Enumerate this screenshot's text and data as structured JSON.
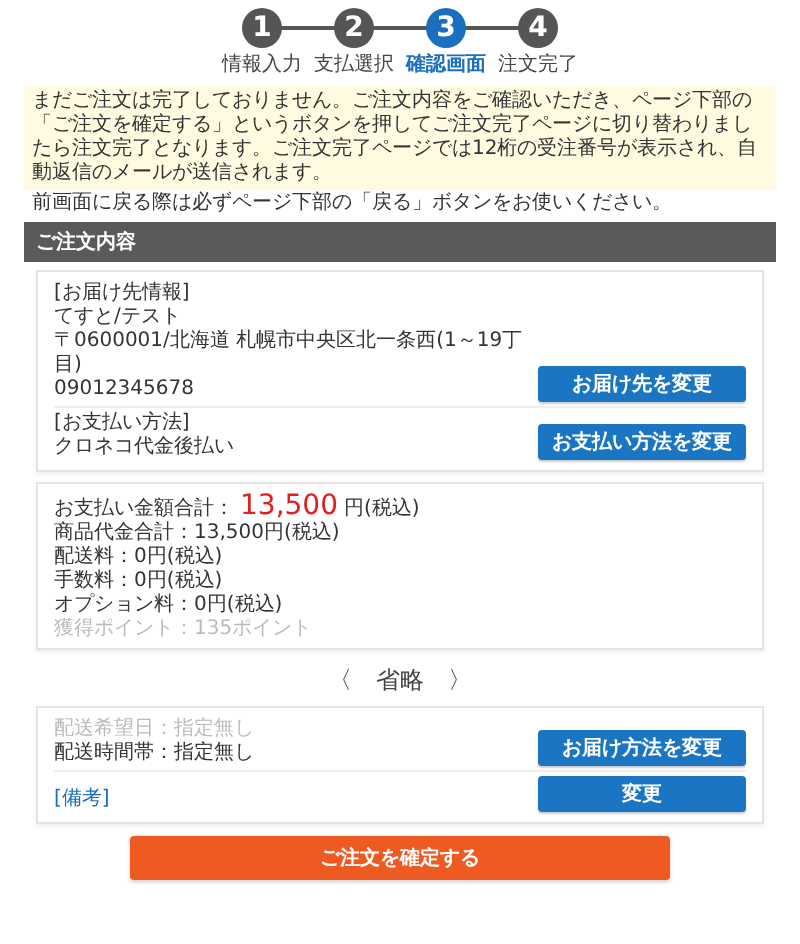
{
  "steps": [
    {
      "number": "1",
      "label": "情報入力",
      "selected": false
    },
    {
      "number": "2",
      "label": "支払選択",
      "selected": false
    },
    {
      "number": "3",
      "label": "確認画面",
      "selected": true
    },
    {
      "number": "4",
      "label": "注文完了",
      "selected": false
    }
  ],
  "notice": {
    "text": "まだご注文は完了しておりません。ご注文内容をご確認いただき、ページ下部の「ご注文を確定する」というボタンを押してご注文完了ページに切り替わりましたら注文完了となります。ご注文完了ページでは12桁の受注番号が表示され、自動返信のメールが送信されます。",
    "note": "前画面に戻る際は必ずページ下部の「戻る」ボタンをお使いください。"
  },
  "section_title": "ご注文内容",
  "order_card": [
    {
      "heading": "[お届け先情報]",
      "lines": [
        "てすと/テスト",
        "〒0600001/北海道 札幌市中央区北一条西(1～19丁目)",
        "09012345678"
      ],
      "button": "お届け先を変更"
    },
    {
      "heading": "[お支払い方法]",
      "lines": [
        "クロネコ代金後払い"
      ],
      "button": "お支払い方法を変更"
    }
  ],
  "totals": {
    "label": "お支払い金額合計：",
    "amount": "13,500",
    "suffix": "円(税込)",
    "lines": [
      {
        "text": "商品代金合計：13,500円(税込)",
        "faded": false
      },
      {
        "text": "配送料：0円(税込)",
        "faded": false
      },
      {
        "text": "手数料：0円(税込)",
        "faded": false
      },
      {
        "text": "オプション料：0円(税込)",
        "faded": false
      },
      {
        "text": "獲得ポイント：135ポイント",
        "faded": true
      }
    ]
  },
  "omitted": "〈　省略　〉",
  "delivery": {
    "lines": [
      {
        "text": "配送希望日：指定無し",
        "faded": true
      },
      {
        "text": "配送時間帯：指定無し",
        "faded": false
      }
    ],
    "button": "お届け方法を変更"
  },
  "remarks": {
    "heading": "[備考]",
    "button": "変更"
  },
  "confirm_button": "ご注文を確定する"
}
